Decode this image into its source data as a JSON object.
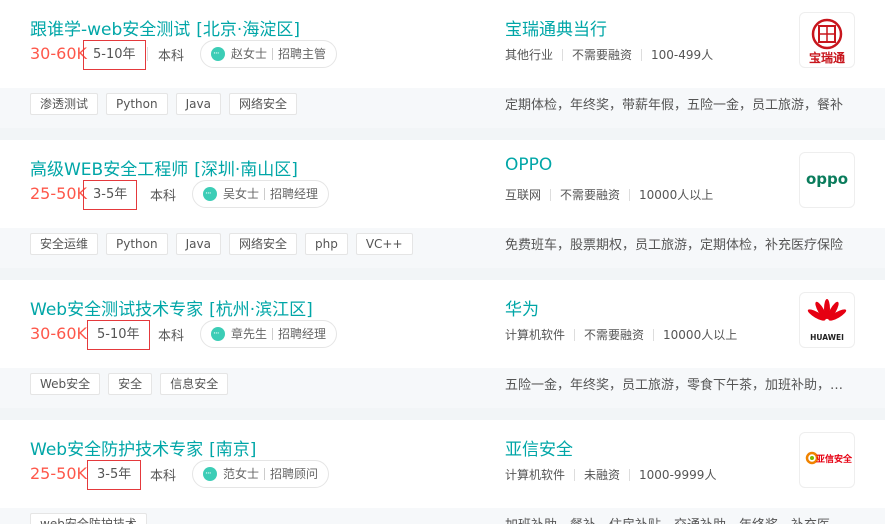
{
  "jobs": [
    {
      "title": "跟谁学-web安全测试",
      "area": "[北京·海淀区]",
      "salary": "30-60K",
      "experience": "5-10年",
      "degree": "本科",
      "recruiter_name": "赵女士",
      "recruiter_role": "招聘主管",
      "company": "宝瑞通典当行",
      "industry": "其他行业",
      "funding": "不需要融资",
      "size": "100-499人",
      "tags": [
        "渗透测试",
        "Python",
        "Java",
        "网络安全"
      ],
      "benefits": "定期体检，年终奖，带薪年假，五险一金，员工旅游，餐补",
      "logo_text": "宝瑞通",
      "logo_icon": "baoruitong-logo-icon"
    },
    {
      "title": "高级WEB安全工程师",
      "area": "[深圳·南山区]",
      "salary": "25-50K",
      "experience": "3-5年",
      "degree": "本科",
      "recruiter_name": "吴女士",
      "recruiter_role": "招聘经理",
      "company": "OPPO",
      "industry": "互联网",
      "funding": "不需要融资",
      "size": "10000人以上",
      "tags": [
        "安全运维",
        "Python",
        "Java",
        "网络安全",
        "php",
        "VC++"
      ],
      "benefits": "免费班车，股票期权，员工旅游，定期体检，补充医疗保险",
      "logo_text": "oppo",
      "logo_icon": "oppo-logo-icon"
    },
    {
      "title": "Web安全测试技术专家",
      "area": "[杭州·滨江区]",
      "salary": "30-60K",
      "experience": "5-10年",
      "degree": "本科",
      "recruiter_name": "章先生",
      "recruiter_role": "招聘经理",
      "company": "华为",
      "industry": "计算机软件",
      "funding": "不需要融资",
      "size": "10000人以上",
      "tags": [
        "Web安全",
        "安全",
        "信息安全"
      ],
      "benefits": "五险一金，年终奖，员工旅游，零食下午茶，加班补助，节日福利",
      "logo_text": "HUAWEI",
      "logo_icon": "huawei-logo-icon"
    },
    {
      "title": "Web安全防护技术专家",
      "area": "[南京]",
      "salary": "25-50K",
      "experience": "3-5年",
      "degree": "本科",
      "recruiter_name": "范女士",
      "recruiter_role": "招聘顾问",
      "company": "亚信安全",
      "industry": "计算机软件",
      "funding": "未融资",
      "size": "1000-9999人",
      "tags": [
        "web安全防护技术"
      ],
      "benefits": "加班补助，餐补，住房补贴，交通补助，年终奖，补充医疗保险",
      "logo_text": "亚信安全",
      "logo_icon": "asiainfo-logo-icon"
    }
  ],
  "colors": {
    "accent": "#00a6a7",
    "salary": "#fe574a",
    "highlight_border": "#e4393c"
  }
}
